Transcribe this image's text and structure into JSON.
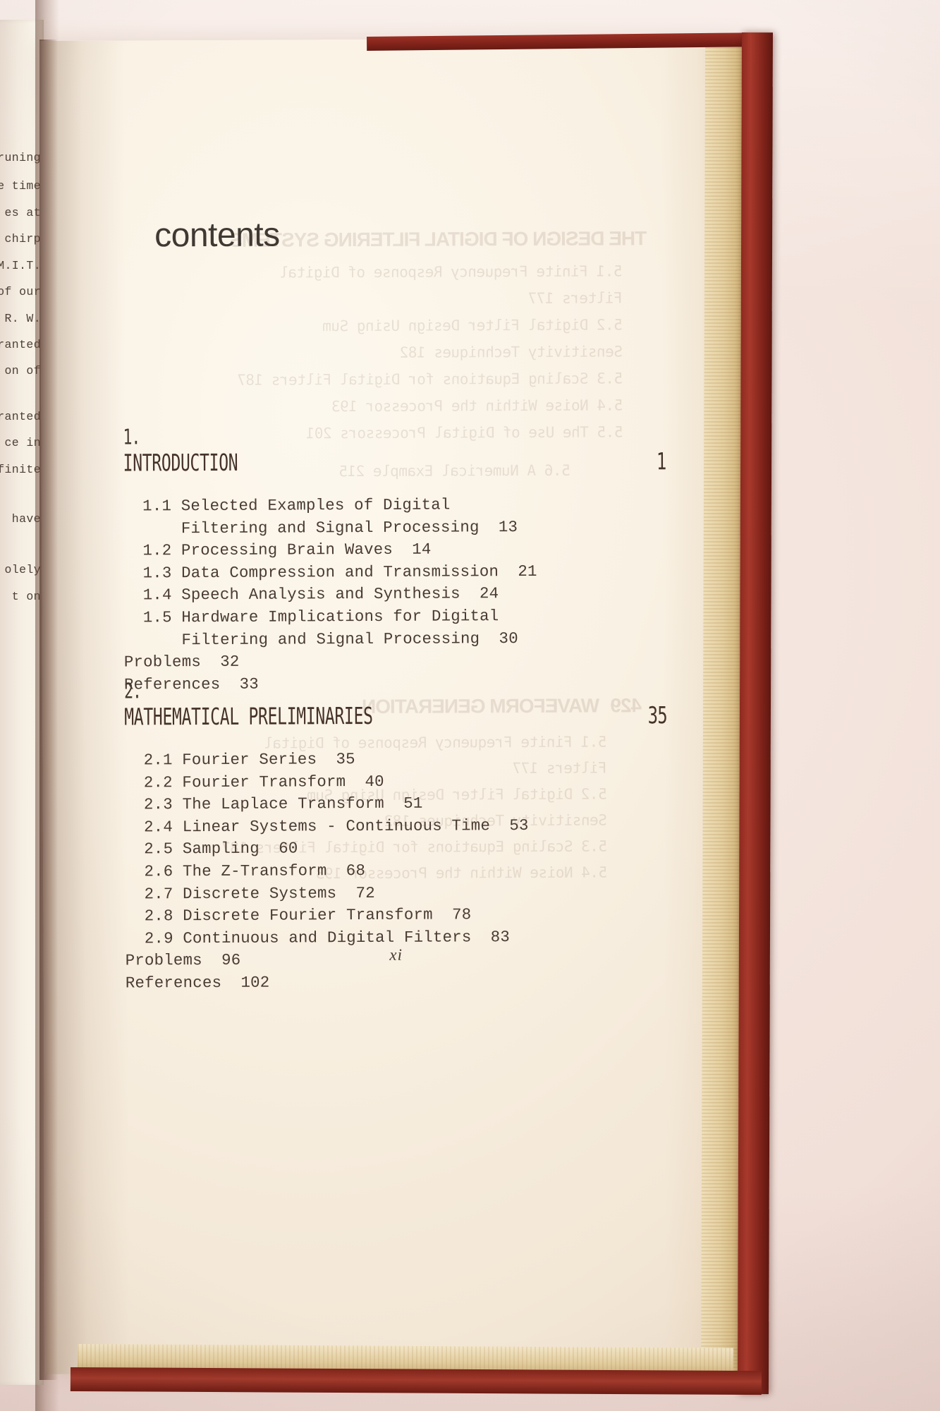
{
  "book": {
    "page_heading": "contents",
    "folio": "xi",
    "cover_color": "#8d2a20",
    "paper_color": "#f9f1e3",
    "ink_color": "#4a3b33"
  },
  "left_page_fragments": [
    "pruning",
    "e time",
    "es at",
    "r chirp",
    "M.I.T.",
    "of our",
    "R.  W.",
    "ranted",
    "on  of",
    "ranted",
    "ce  in",
    "finite",
    "have",
    "olely",
    "t  on"
  ],
  "chapters": [
    {
      "number": "1.",
      "title": "INTRODUCTION",
      "page": "1",
      "entries": [
        {
          "num": "1.1",
          "text": "Selected Examples of Digital",
          "page": "",
          "indent": false,
          "cont": false
        },
        {
          "num": "",
          "text": "Filtering and Signal Processing",
          "page": "13",
          "indent": true,
          "cont": true
        },
        {
          "num": "1.2",
          "text": "Processing Brain Waves",
          "page": "14",
          "indent": false,
          "cont": false
        },
        {
          "num": "1.3",
          "text": "Data Compression and Transmission",
          "page": "21",
          "indent": false,
          "cont": false
        },
        {
          "num": "1.4",
          "text": "Speech Analysis and Synthesis",
          "page": "24",
          "indent": false,
          "cont": false
        },
        {
          "num": "1.5",
          "text": "Hardware Implications for Digital",
          "page": "",
          "indent": false,
          "cont": false
        },
        {
          "num": "",
          "text": "Filtering and Signal Processing",
          "page": "30",
          "indent": true,
          "cont": true
        },
        {
          "num": "",
          "text": "Problems",
          "page": "32",
          "indent": false,
          "cont": false,
          "flush": true
        },
        {
          "num": "",
          "text": "References",
          "page": "33",
          "indent": false,
          "cont": false,
          "flush": true
        }
      ],
      "lines": [
        "  1.1 Selected Examples of Digital",
        "      Filtering and Signal Processing  13",
        "  1.2 Processing Brain Waves  14",
        "  1.3 Data Compression and Transmission  21",
        "  1.4 Speech Analysis and Synthesis  24",
        "  1.5 Hardware Implications for Digital",
        "      Filtering and Signal Processing  30",
        "Problems  32",
        "References  33"
      ]
    },
    {
      "number": "2.",
      "title": "MATHEMATICAL PRELIMINARIES",
      "page": "35",
      "entries": [
        {
          "num": "2.1",
          "text": "Fourier Series",
          "page": "35"
        },
        {
          "num": "2.2",
          "text": "Fourier Transform",
          "page": "40"
        },
        {
          "num": "2.3",
          "text": "The Laplace Transform",
          "page": "51"
        },
        {
          "num": "2.4",
          "text": "Linear Systems - Continuous Time",
          "page": "53"
        },
        {
          "num": "2.5",
          "text": "Sampling",
          "page": "60"
        },
        {
          "num": "2.6",
          "text": "The Z-Transform",
          "page": "68"
        },
        {
          "num": "2.7",
          "text": "Discrete Systems",
          "page": "72"
        },
        {
          "num": "2.8",
          "text": "Discrete Fourier Transform",
          "page": "78"
        },
        {
          "num": "2.9",
          "text": "Continuous and Digital Filters",
          "page": "83"
        },
        {
          "num": "",
          "text": "Problems",
          "page": "96",
          "flush": true
        },
        {
          "num": "",
          "text": "References",
          "page": "102",
          "flush": true
        }
      ],
      "lines": [
        "  2.1 Fourier Series  35",
        "  2.2 Fourier Transform  40",
        "  2.3 The Laplace Transform  51",
        "  2.4 Linear Systems - Continuous Time  53",
        "  2.5 Sampling  60",
        "  2.6 The Z-Transform  68",
        "  2.7 Discrete Systems  72",
        "  2.8 Discrete Fourier Transform  78",
        "  2.9 Continuous and Digital Filters  83",
        "Problems  96",
        "References  102"
      ]
    }
  ],
  "bleed_through": {
    "headings": [
      "THE DESIGN OF DIGITAL FILTERING SYSTEMS",
      "WAVEFORM GENERATION"
    ],
    "lines": [
      "5.1 Finite Frequency Response of Digital",
      "Filters  177",
      "5.2 Digital Filter Design Using Sum",
      "Sensitivity Techniques  182",
      "5.3 Scaling Equations for Digital Filters  187",
      "5.4 Noise Within the Processor  193",
      "5.5 The Use of Digital Processors  201",
      "5.6 A Numerical Example  215",
      "429"
    ]
  }
}
